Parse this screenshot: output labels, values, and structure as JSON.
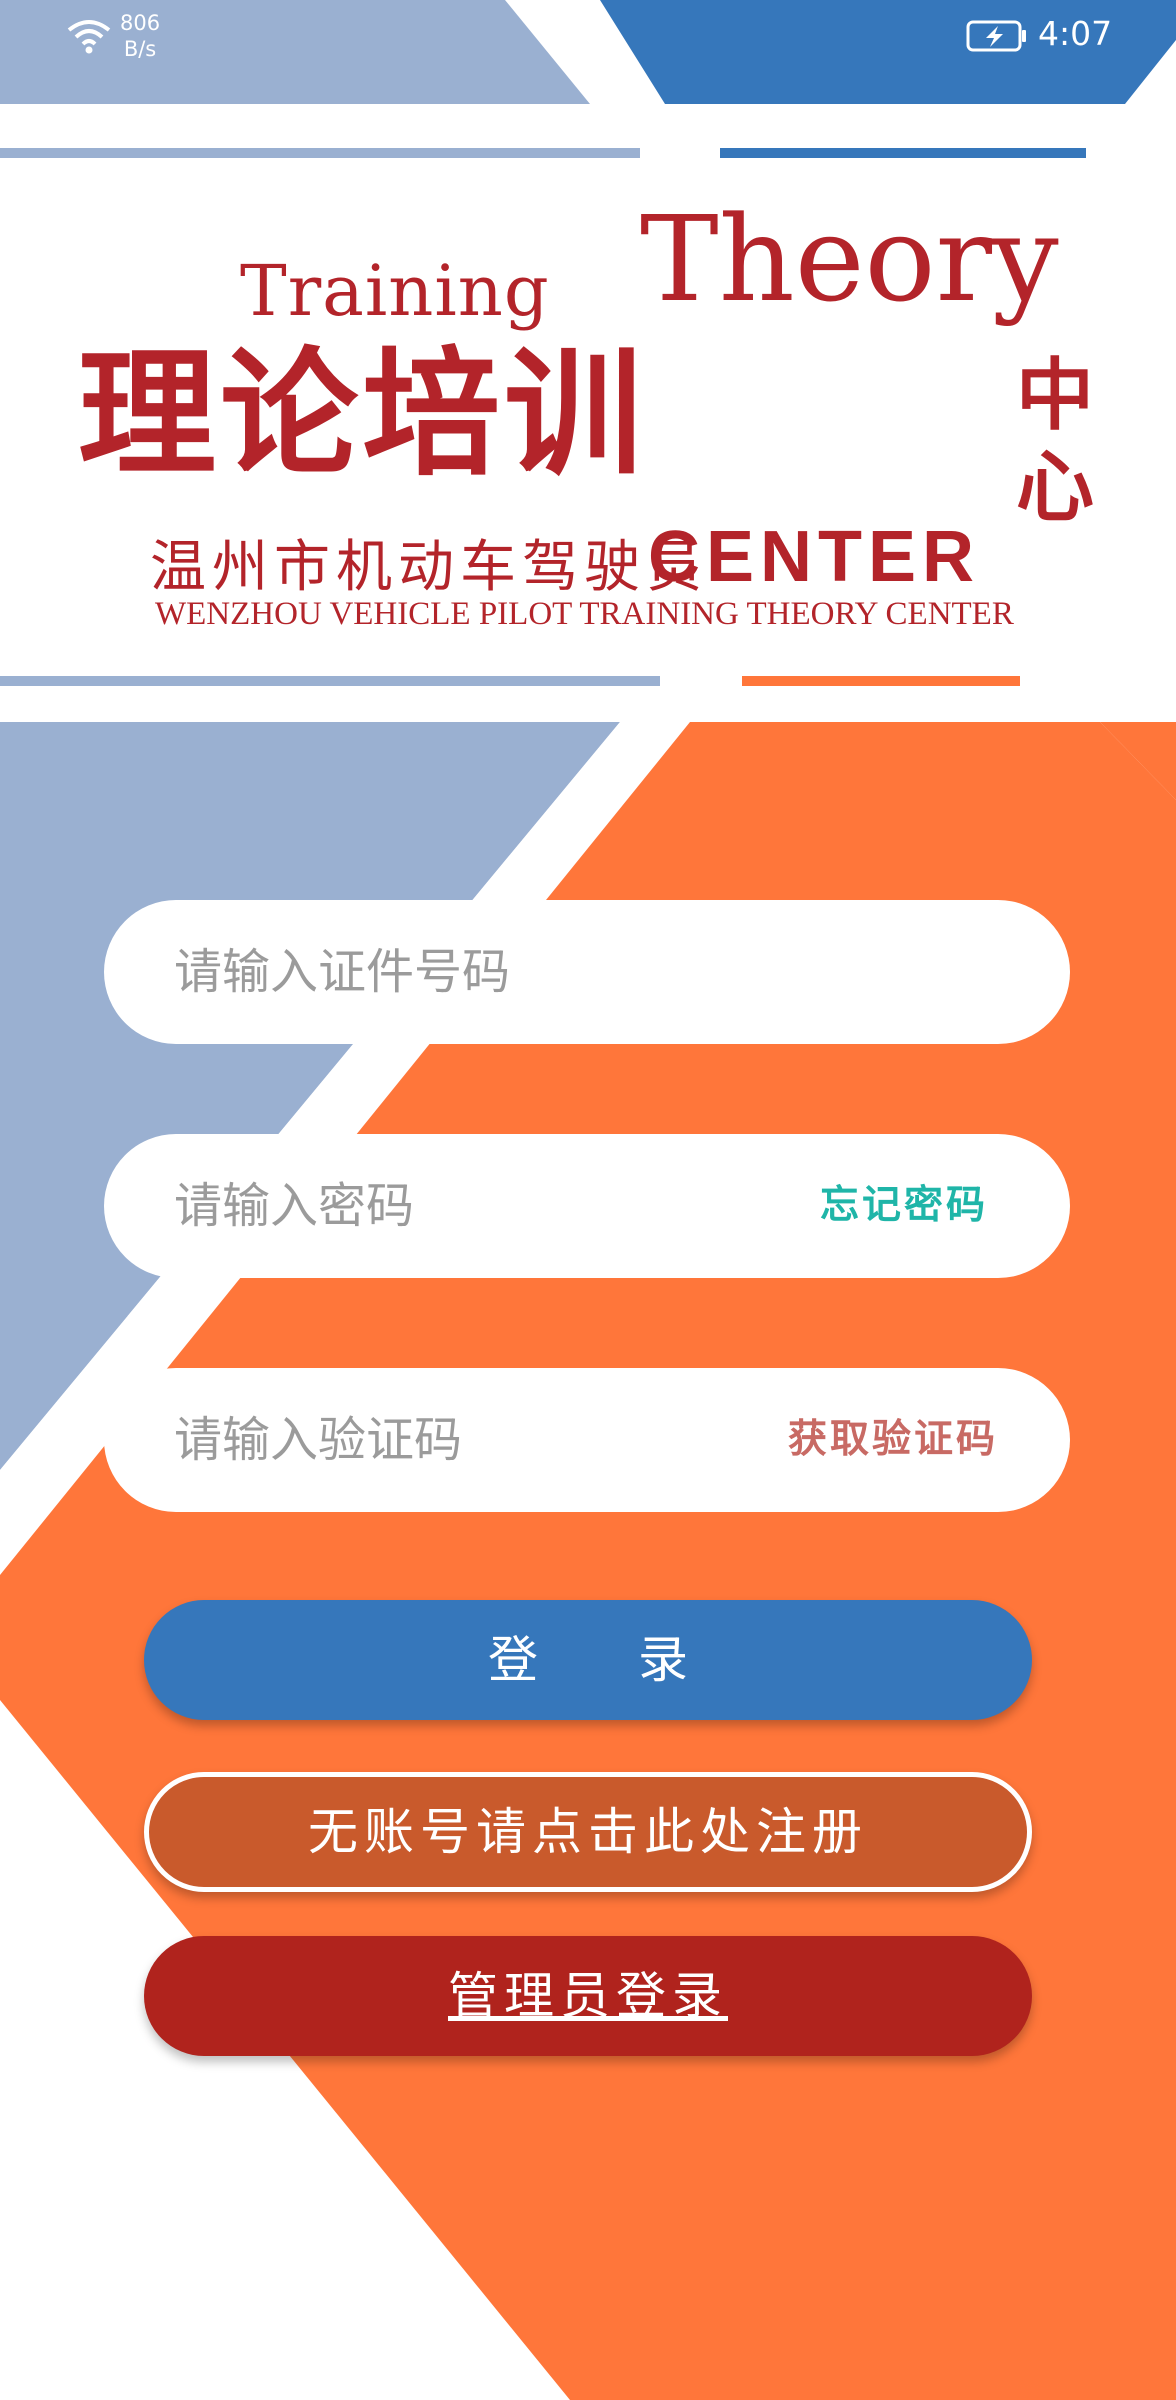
{
  "status_bar": {
    "net_speed_value": "806",
    "net_speed_unit": "B/s",
    "time": "4:07"
  },
  "logo": {
    "en_training": "Training",
    "en_theory": "Theory",
    "cn_title": "理论培训",
    "cn_side": "中心",
    "cn_subtitle": "温州市机动车驾驶员",
    "en_center": "CENTER",
    "en_full": "WENZHOU VEHICLE PILOT TRAINING THEORY CENTER"
  },
  "form": {
    "id_placeholder": "请输入证件号码",
    "password_placeholder": "请输入密码",
    "forgot_password": "忘记密码",
    "code_placeholder": "请输入验证码",
    "get_code": "获取验证码"
  },
  "buttons": {
    "login": "登　　录",
    "register": "无账号请点击此处注册",
    "admin_login": "管理员登录"
  },
  "colors": {
    "blue": "#3677bb",
    "light_blue": "#9ab0d1",
    "orange": "#ff763a",
    "brand_red": "#b3242a",
    "teal_link": "#1fb5a8",
    "rose_link": "#c86a64"
  },
  "icons": {
    "wifi": "wifi-icon",
    "battery": "battery-charging-icon"
  }
}
